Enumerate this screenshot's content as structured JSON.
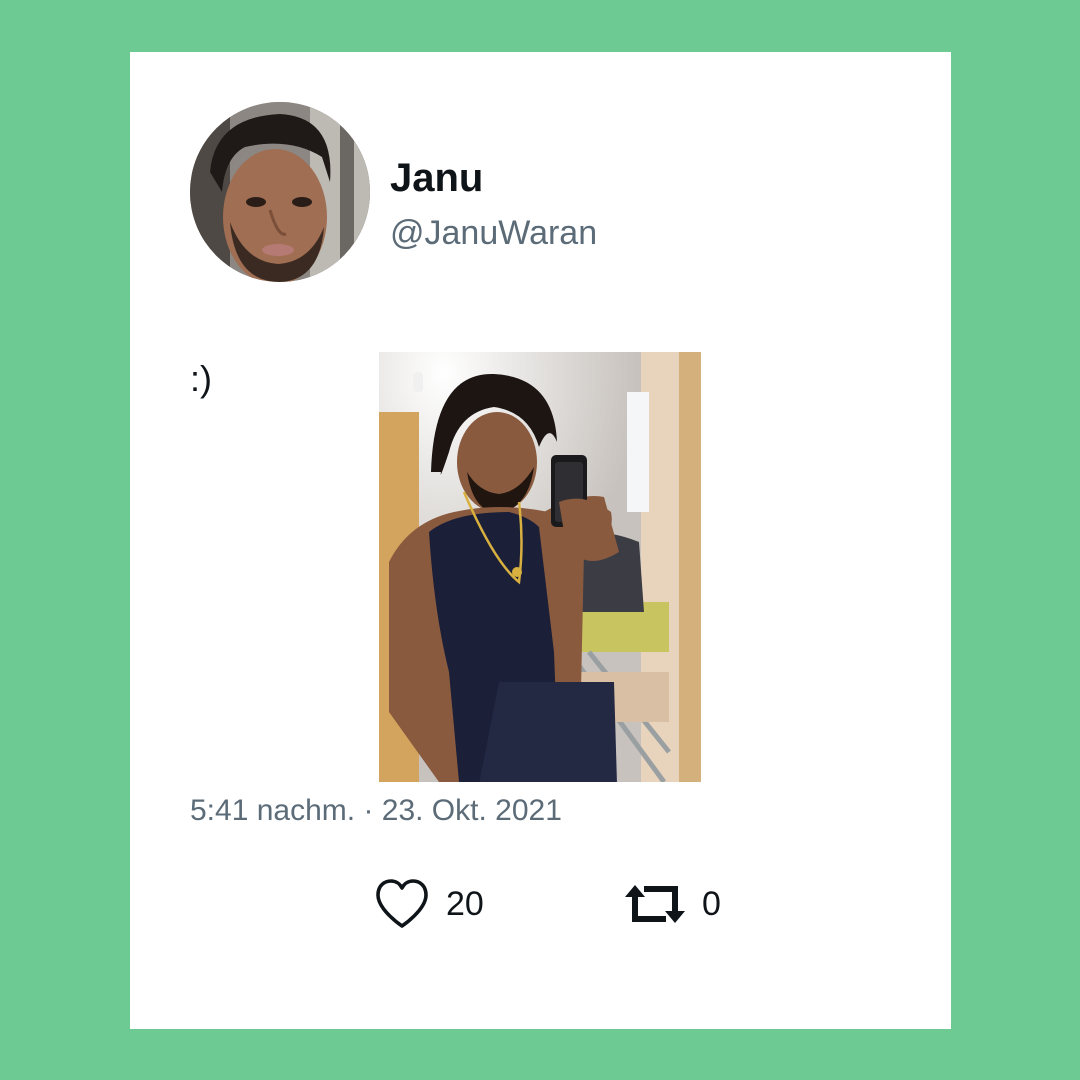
{
  "author": {
    "display_name": "Janu",
    "handle": "@JanuWaran",
    "avatar_icon": "profile-photo"
  },
  "tweet": {
    "text": ":)",
    "timestamp": "5:41 nachm. · 23. Okt. 2021",
    "media_icon": "mirror-selfie-photo"
  },
  "actions": {
    "likes_count": "20",
    "retweets_count": "0",
    "like_icon": "heart-icon",
    "retweet_icon": "retweet-icon"
  },
  "colors": {
    "background": "#6dca93",
    "card": "#ffffff",
    "primary_text": "#0f1419",
    "secondary_text": "#5b6b78"
  }
}
